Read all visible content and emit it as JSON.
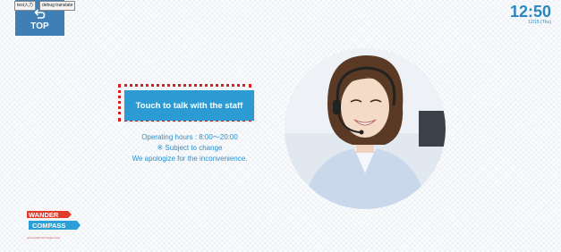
{
  "debug": {
    "btn1": "text入力",
    "btn2": "debug translate"
  },
  "nav": {
    "top_label": "TOP"
  },
  "clock": {
    "time": "12:50",
    "date": "12/15 (Thu)"
  },
  "main": {
    "cta_label": "Touch to talk with the staff",
    "hours": "Operating hours : 8:00～20:00",
    "note": "※ Subject to change",
    "apology": "We apologize for the inconvenience."
  },
  "logo": {
    "line1": "WANDER",
    "line2": "COMPASS",
    "tagline": "your perfect trip begins here"
  },
  "colors": {
    "accent": "#2d9bd3",
    "highlight": "#e01d1d",
    "top_button": "#3f7fb5"
  }
}
